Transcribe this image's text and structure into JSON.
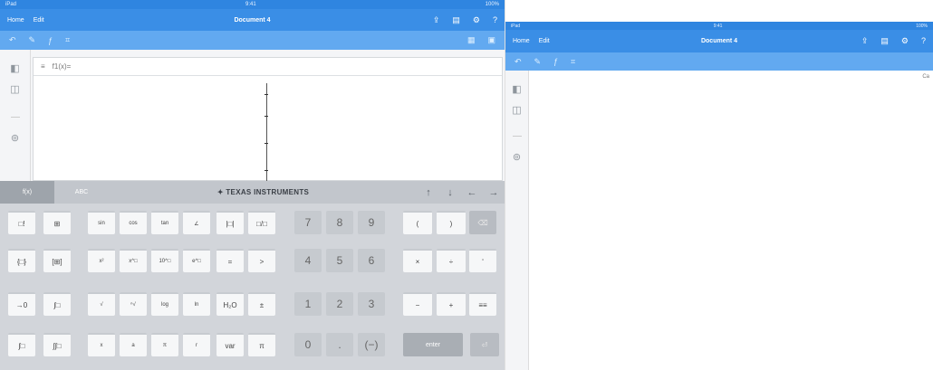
{
  "left": {
    "statusbar": {
      "left": "iPad",
      "center": "9:41",
      "right": "100%"
    },
    "titlebar": {
      "nav": [
        "Home",
        "Edit"
      ],
      "title": "Document 4",
      "icons": [
        "share-icon",
        "docs-icon",
        "settings-icon",
        "help-icon"
      ]
    },
    "toolbar": {
      "icons": [
        "wrench-icon",
        "functions-icon",
        "graph-icon"
      ]
    },
    "function_bar": {
      "menu_glyph": "≡",
      "label": "f1(x)="
    },
    "keyboard": {
      "tabs": [
        "f(x)",
        "ABC"
      ],
      "brand": "TEXAS INSTRUMENTS",
      "arrows": [
        "↑",
        "↓",
        "←",
        "→"
      ],
      "rows": [
        [
          "□!",
          "⊞",
          "sin",
          "cos",
          "tan",
          "∠",
          "|□|",
          "□/□",
          "7",
          "8",
          "9",
          "(",
          ")",
          "⌫"
        ],
        [
          "{□}",
          "[⊞]",
          "x²",
          "x^□",
          "10^□",
          "e^□",
          "=",
          ">",
          "4",
          "5",
          "6",
          "×",
          "÷",
          "ʹ"
        ],
        [
          "→0",
          "∫□",
          "√",
          "ⁿ√",
          "log",
          "ln",
          "H₂O",
          "±",
          "1",
          "2",
          "3",
          "−",
          "+",
          "≡≡"
        ],
        [
          "∫□",
          "∫∫□",
          "x",
          "a",
          "π",
          "r",
          "var",
          "π",
          "0",
          ".",
          "(−)",
          "enter",
          "⏎"
        ]
      ]
    }
  },
  "right": {
    "statusbar": {
      "left": "iPad",
      "center": "9:41",
      "right": "100%"
    },
    "titlebar": {
      "nav": [
        "Home",
        "Edit"
      ],
      "title": "Document 4",
      "icons": [
        "share-icon",
        "docs-icon",
        "settings-icon",
        "help-icon"
      ]
    },
    "toolbar": {
      "icons": [
        "wrench-icon",
        "functions-icon",
        "graph-icon"
      ]
    },
    "edge_hint": "Ca"
  }
}
